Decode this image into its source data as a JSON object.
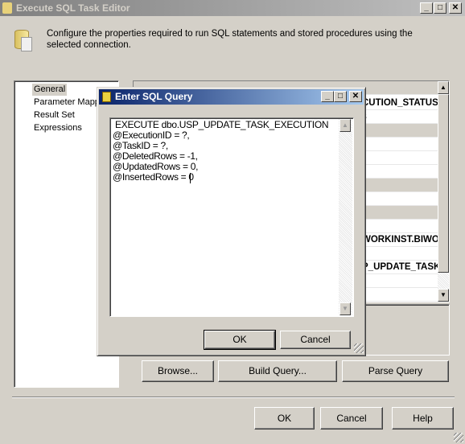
{
  "window": {
    "title": "Execute SQL Task Editor",
    "header_text": "Configure the properties required to run SQL statements and stored procedures using the selected connection."
  },
  "nav": {
    "items": [
      {
        "label": "General"
      },
      {
        "label": "Parameter Mapping"
      },
      {
        "label": "Result Set"
      },
      {
        "label": "Expressions"
      }
    ]
  },
  "grid": {
    "visible_values": [
      "CUTION_STATUS",
      "s",
      "WORKINST.BIWO",
      "P_UPDATE_TASK"
    ]
  },
  "buttons": {
    "browse": "Browse...",
    "build_query": "Build Query...",
    "parse_query": "Parse Query",
    "ok": "OK",
    "cancel": "Cancel",
    "help": "Help"
  },
  "dialog": {
    "title": "Enter SQL Query",
    "query": " EXECUTE dbo.USP_UPDATE_TASK_EXECUTION\n@ExecutionID = ?,\n@TaskID = ?,\n@DeletedRows = -1,\n@UpdatedRows = 0,\n@InsertedRows = 0 ",
    "ok": "OK",
    "cancel": "Cancel"
  },
  "colors": {
    "active_title": "#0a246a",
    "inactive_title": "#808080",
    "face": "#d4d0c8"
  }
}
